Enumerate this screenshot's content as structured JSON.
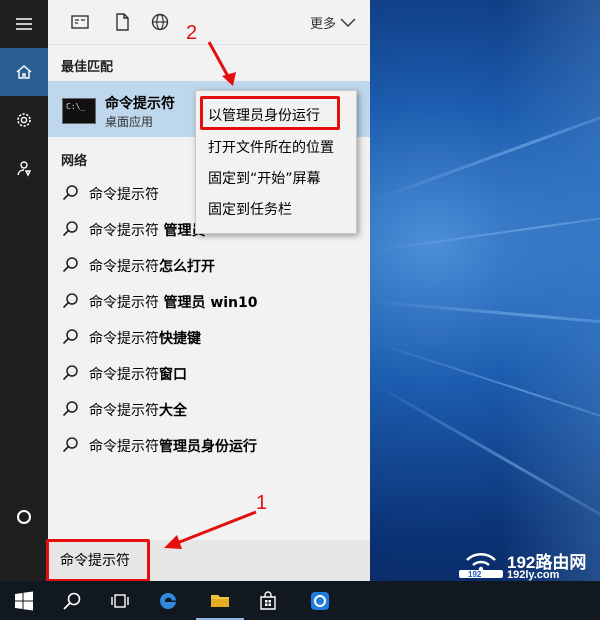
{
  "panel": {
    "more_label": "更多",
    "best_match_heading": "最佳匹配",
    "best_match": {
      "title": "命令提示符",
      "subtitle": "桌面应用"
    },
    "web_heading": "网络",
    "web_results": [
      {
        "normal": "命令提示符",
        "bold": ""
      },
      {
        "normal": "命令提示符 ",
        "bold": "管理员"
      },
      {
        "normal": "命令提示符",
        "bold": "怎么打开"
      },
      {
        "normal": "命令提示符 ",
        "bold": "管理员 win10"
      },
      {
        "normal": "命令提示符",
        "bold": "快捷键"
      },
      {
        "normal": "命令提示符",
        "bold": "窗口"
      },
      {
        "normal": "命令提示符",
        "bold": "大全"
      },
      {
        "normal": "命令提示符",
        "bold": "管理员身份运行"
      }
    ],
    "search_query": "命令提示符"
  },
  "context_menu": {
    "items": [
      "以管理员身份运行",
      "打开文件所在的位置",
      "固定到“开始”屏幕",
      "固定到任务栏"
    ]
  },
  "annotations": {
    "step1": "1",
    "step2": "2",
    "color": "#e41010"
  },
  "watermark": {
    "brand": "192路由网",
    "url": "192ly.com",
    "badge": "192"
  },
  "colors": {
    "rail": "#1f1f1f",
    "rail_active": "#2a5f92",
    "best_match_bg": "#bfd7ec",
    "panel_bg": "#f2f2f2",
    "taskbar": "#111820"
  }
}
